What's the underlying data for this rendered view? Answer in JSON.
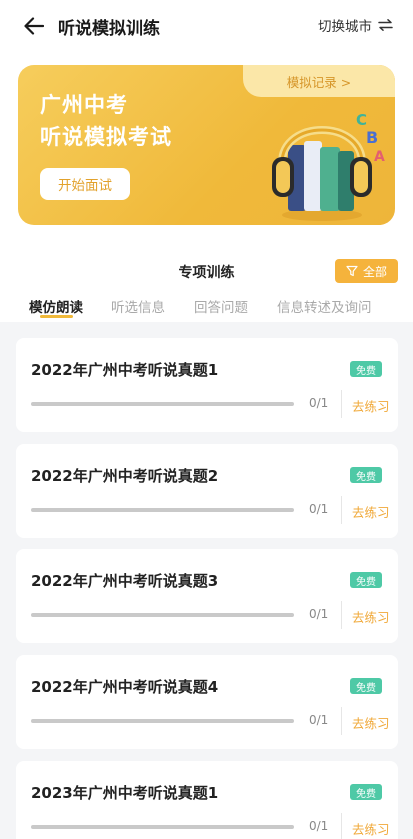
{
  "header": {
    "title": "听说模拟训练",
    "switch_city_label": "切换城市"
  },
  "banner": {
    "records_link": "模拟记录 >",
    "title_line1": "广州中考",
    "title_line2": "听说模拟考试",
    "start_button": "开始面试",
    "illustration_letters": [
      "C",
      "B",
      "A"
    ]
  },
  "section": {
    "title": "专项训练",
    "filter_label": "全部"
  },
  "tabs": [
    {
      "label": "模仿朗读",
      "active": true
    },
    {
      "label": "听选信息",
      "active": false
    },
    {
      "label": "回答问题",
      "active": false
    },
    {
      "label": "信息转述及询问",
      "active": false
    }
  ],
  "cards": [
    {
      "title": "2022年广州中考听说真题1",
      "badge": "免费",
      "progress_text": "0/1",
      "progress": 0,
      "action": "去练习"
    },
    {
      "title": "2022年广州中考听说真题2",
      "badge": "免费",
      "progress_text": "0/1",
      "progress": 0,
      "action": "去练习"
    },
    {
      "title": "2022年广州中考听说真题3",
      "badge": "免费",
      "progress_text": "0/1",
      "progress": 0,
      "action": "去练习"
    },
    {
      "title": "2022年广州中考听说真题4",
      "badge": "免费",
      "progress_text": "0/1",
      "progress": 0,
      "action": "去练习"
    },
    {
      "title": "2023年广州中考听说真题1",
      "badge": "免费",
      "progress_text": "0/1",
      "progress": 0,
      "action": "去练习"
    }
  ],
  "colors": {
    "accent": "#f0b93a",
    "badge_green": "#4ec9a6",
    "list_background": "#f4f5f7"
  }
}
